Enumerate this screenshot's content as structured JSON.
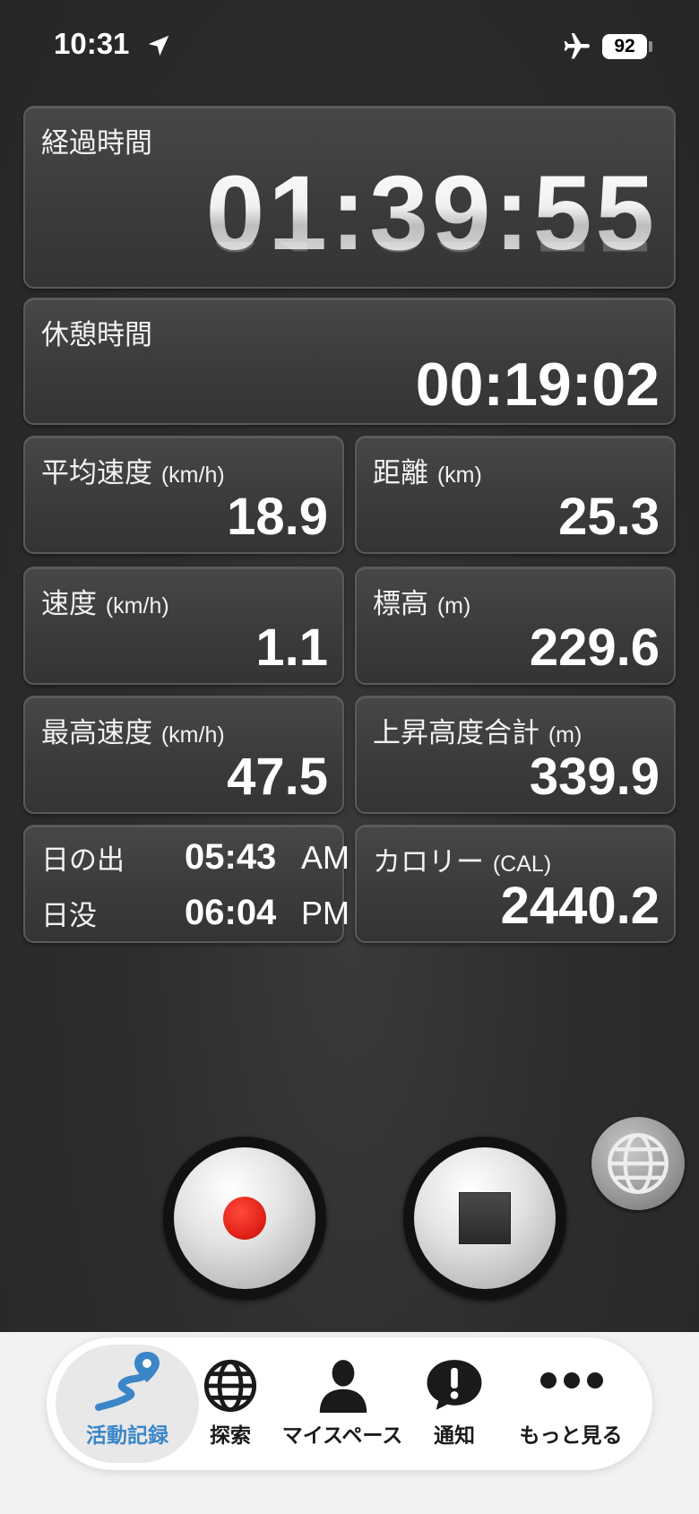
{
  "status": {
    "time": "10:31",
    "battery": "92"
  },
  "stats": {
    "elapsed": {
      "label": "経過時間",
      "value": "01:39:55"
    },
    "rest": {
      "label": "休憩時間",
      "value": "00:19:02"
    },
    "avg_speed": {
      "label": "平均速度",
      "unit": "(km/h)",
      "value": "18.9"
    },
    "distance": {
      "label": "距離",
      "unit": "(km)",
      "value": "25.3"
    },
    "speed": {
      "label": "速度",
      "unit": "(km/h)",
      "value": "1.1"
    },
    "altitude": {
      "label": "標高",
      "unit": "(m)",
      "value": "229.6"
    },
    "max_speed": {
      "label": "最高速度",
      "unit": "(km/h)",
      "value": "47.5"
    },
    "total_ascent": {
      "label": "上昇高度合計",
      "unit": "(m)",
      "value": "339.9"
    },
    "sun": {
      "sunrise_label": "日の出",
      "sunrise_time": "05:43",
      "sunrise_ampm": "AM",
      "sunset_label": "日没",
      "sunset_time": "06:04",
      "sunset_ampm": "PM"
    },
    "calories": {
      "label": "カロリー",
      "unit": "(CAL)",
      "value": "2440.2"
    }
  },
  "controls": {
    "record_icon": "record-icon",
    "stop_icon": "stop-icon",
    "map_icon": "globe-icon"
  },
  "tabs": [
    {
      "label": "活動記録",
      "icon": "route-icon",
      "active": true
    },
    {
      "label": "探索",
      "icon": "globe-icon",
      "active": false
    },
    {
      "label": "マイスペース",
      "icon": "person-icon",
      "active": false
    },
    {
      "label": "通知",
      "icon": "alert-bubble-icon",
      "active": false
    },
    {
      "label": "もっと見る",
      "icon": "more-dots-icon",
      "active": false
    }
  ],
  "colors": {
    "accent": "#3a86c8",
    "record": "#e2231a",
    "background": "#2b2b2b"
  }
}
